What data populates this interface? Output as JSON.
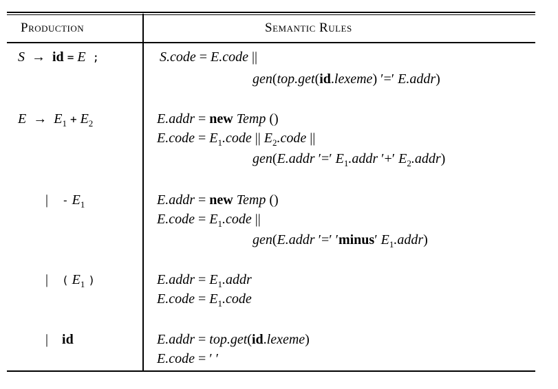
{
  "header": {
    "production": "Production",
    "semantic_rules": "Semantic Rules"
  },
  "rows": [
    {
      "production": "S → id = E ;",
      "rules": [
        "S.code = E.code ||",
        "gen(top.get(id.lexeme) '=' E.addr)"
      ]
    },
    {
      "production": "E → E1 + E2",
      "rules": [
        "E.addr = new Temp ()",
        "E.code = E1.code || E2.code ||",
        "gen(E.addr '=' E1.addr '+' E2.addr)"
      ]
    },
    {
      "production": "| - E1",
      "rules": [
        "E.addr = new Temp ()",
        "E.code = E1.code ||",
        "gen(E.addr '=' 'minus' E1.addr)"
      ]
    },
    {
      "production": "| ( E1 )",
      "rules": [
        "E.addr = E1.addr",
        "E.code = E1.code"
      ]
    },
    {
      "production": "| id",
      "rules": [
        "E.addr = top.get(id.lexeme)",
        "E.code = ''"
      ]
    }
  ]
}
